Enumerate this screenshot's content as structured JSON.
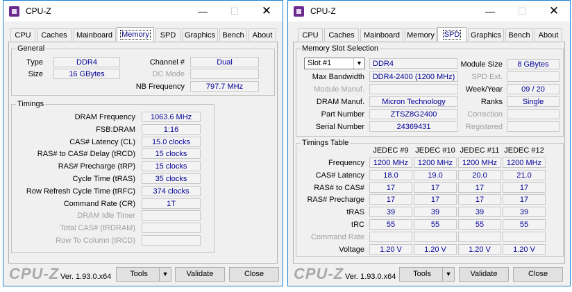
{
  "app_title": "CPU-Z",
  "tabs": [
    "CPU",
    "Caches",
    "Mainboard",
    "Memory",
    "SPD",
    "Graphics",
    "Bench",
    "About"
  ],
  "footer": {
    "logo": "CPU-Z",
    "version": "Ver. 1.93.0.x64",
    "tools": "Tools",
    "validate": "Validate",
    "close": "Close"
  },
  "memory": {
    "general_title": "General",
    "type_label": "Type",
    "type": "DDR4",
    "size_label": "Size",
    "size": "16 GBytes",
    "channel_label": "Channel #",
    "channel": "Dual",
    "dcmode_label": "DC Mode",
    "dcmode": "",
    "nbfreq_label": "NB Frequency",
    "nbfreq": "797.7 MHz",
    "timings_title": "Timings",
    "timings": [
      {
        "label": "DRAM Frequency",
        "value": "1063.6 MHz",
        "enabled": true
      },
      {
        "label": "FSB:DRAM",
        "value": "1:16",
        "enabled": true
      },
      {
        "label": "CAS# Latency (CL)",
        "value": "15.0 clocks",
        "enabled": true
      },
      {
        "label": "RAS# to CAS# Delay (tRCD)",
        "value": "15 clocks",
        "enabled": true
      },
      {
        "label": "RAS# Precharge (tRP)",
        "value": "15 clocks",
        "enabled": true
      },
      {
        "label": "Cycle Time (tRAS)",
        "value": "35 clocks",
        "enabled": true
      },
      {
        "label": "Row Refresh Cycle Time (tRFC)",
        "value": "374 clocks",
        "enabled": true
      },
      {
        "label": "Command Rate (CR)",
        "value": "1T",
        "enabled": true
      },
      {
        "label": "DRAM Idle Timer",
        "value": "",
        "enabled": false
      },
      {
        "label": "Total CAS# (tRDRAM)",
        "value": "",
        "enabled": false
      },
      {
        "label": "Row To Column (tRCD)",
        "value": "",
        "enabled": false
      }
    ]
  },
  "spd": {
    "slot_title": "Memory Slot Selection",
    "slot_selected": "Slot #1",
    "slot_type": "DDR4",
    "module_size_label": "Module Size",
    "module_size": "8 GBytes",
    "max_bw_label": "Max Bandwidth",
    "max_bw": "DDR4-2400 (1200 MHz)",
    "spd_ext_label": "SPD Ext.",
    "spd_ext": "",
    "module_manuf_label": "Module Manuf.",
    "module_manuf": "",
    "week_year_label": "Week/Year",
    "week_year": "09 / 20",
    "dram_manuf_label": "DRAM Manuf.",
    "dram_manuf": "Micron Technology",
    "ranks_label": "Ranks",
    "ranks": "Single",
    "part_label": "Part Number",
    "part": "ZTSZ8G2400",
    "correction_label": "Correction",
    "correction": "",
    "serial_label": "Serial Number",
    "serial": "24369431",
    "registered_label": "Registered",
    "registered": "",
    "table_title": "Timings Table",
    "columns": [
      "JEDEC #9",
      "JEDEC #10",
      "JEDEC #11",
      "JEDEC #12"
    ],
    "rows": [
      {
        "label": "Frequency",
        "values": [
          "1200 MHz",
          "1200 MHz",
          "1200 MHz",
          "1200 MHz"
        ],
        "enabled": true
      },
      {
        "label": "CAS# Latency",
        "values": [
          "18.0",
          "19.0",
          "20.0",
          "21.0"
        ],
        "enabled": true
      },
      {
        "label": "RAS# to CAS#",
        "values": [
          "17",
          "17",
          "17",
          "17"
        ],
        "enabled": true
      },
      {
        "label": "RAS# Precharge",
        "values": [
          "17",
          "17",
          "17",
          "17"
        ],
        "enabled": true
      },
      {
        "label": "tRAS",
        "values": [
          "39",
          "39",
          "39",
          "39"
        ],
        "enabled": true
      },
      {
        "label": "tRC",
        "values": [
          "55",
          "55",
          "55",
          "55"
        ],
        "enabled": true
      },
      {
        "label": "Command Rate",
        "values": [
          "",
          "",
          "",
          ""
        ],
        "enabled": false
      },
      {
        "label": "Voltage",
        "values": [
          "1.20 V",
          "1.20 V",
          "1.20 V",
          "1.20 V"
        ],
        "enabled": true
      }
    ]
  }
}
